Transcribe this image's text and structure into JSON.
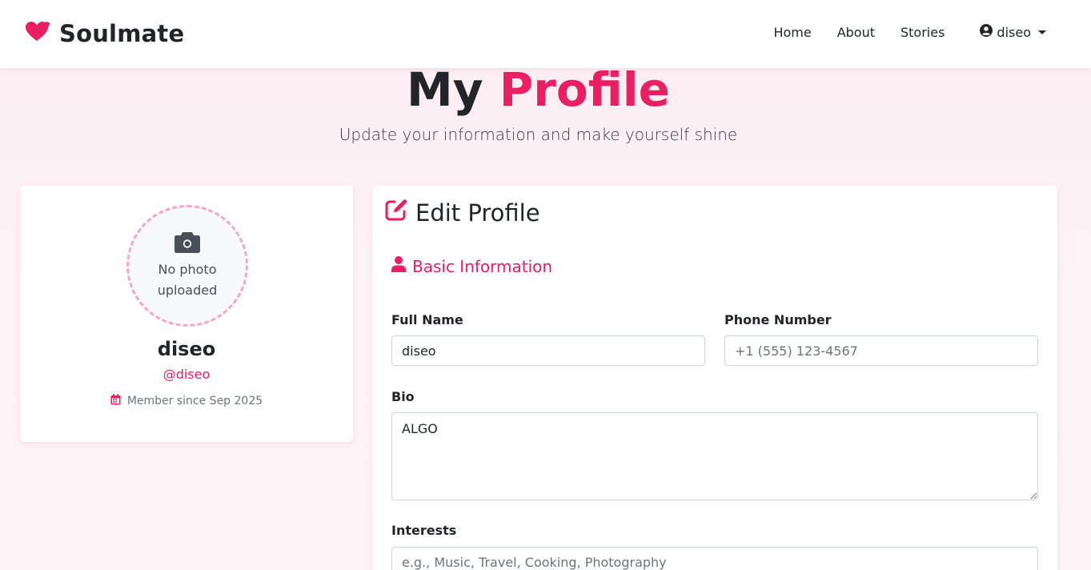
{
  "brand": {
    "name": "Soulmate",
    "accent_color": "#e91e63"
  },
  "nav": {
    "links": [
      "Home",
      "About",
      "Stories"
    ],
    "user": "diseo"
  },
  "hero": {
    "title_plain": "My",
    "title_accent": "Profile",
    "subtitle": "Update your information and make yourself shine"
  },
  "profile": {
    "photo_placeholder": "No photo uploaded",
    "name": "diseo",
    "handle": "@diseo",
    "member_since": "Member since Sep 2025"
  },
  "edit": {
    "title": "Edit Profile",
    "section": "Basic Information",
    "fields": {
      "full_name": {
        "label": "Full Name",
        "value": "diseo",
        "placeholder": ""
      },
      "phone": {
        "label": "Phone Number",
        "value": "",
        "placeholder": "+1 (555) 123-4567"
      },
      "bio": {
        "label": "Bio",
        "value": "ALGO",
        "placeholder": ""
      },
      "interests": {
        "label": "Interests",
        "value": "",
        "placeholder": "e.g., Music, Travel, Cooking, Photography"
      }
    }
  }
}
